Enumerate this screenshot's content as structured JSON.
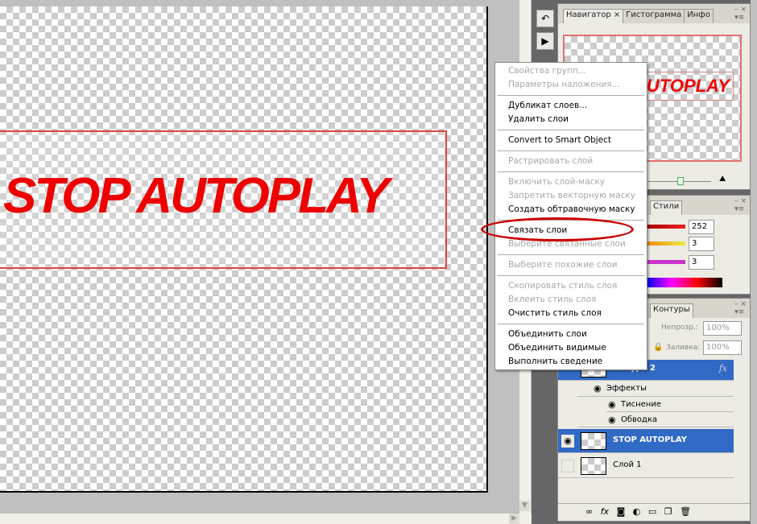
{
  "canvas": {
    "banner_text": "STOP AUTOPLAY"
  },
  "navigator": {
    "tabs": [
      "Навигатор",
      "Гистограмма",
      "Инфо"
    ],
    "close_tab_glyph": "×",
    "preview_text": "AUTOPLAY"
  },
  "color_panel": {
    "tab": "Стили",
    "values": [
      "252",
      "3",
      "3"
    ]
  },
  "layers_panel": {
    "tab": "Контуры",
    "opacity_label": "Непрозр.:",
    "opacity_value": "100%",
    "fill_label": "Заливка:",
    "fill_value": "100%",
    "layers": [
      {
        "name": "Фигура 2",
        "fx": "fx"
      },
      {
        "name": "Эффекты"
      },
      {
        "name": "Тиснение"
      },
      {
        "name": "Обводка"
      },
      {
        "name": "STOP AUTOPLAY"
      },
      {
        "name": "Слой 1"
      }
    ]
  },
  "context_menu": {
    "groups": [
      [
        {
          "label": "Свойства групп...",
          "enabled": false
        },
        {
          "label": "Параметры наложения...",
          "enabled": false
        }
      ],
      [
        {
          "label": "Дубликат слоев...",
          "enabled": true
        },
        {
          "label": "Удалить слои",
          "enabled": true
        }
      ],
      [
        {
          "label": "Convert to Smart Object",
          "enabled": true
        }
      ],
      [
        {
          "label": "Растрировать слой",
          "enabled": false
        }
      ],
      [
        {
          "label": "Включить слой-маску",
          "enabled": false
        },
        {
          "label": "Запретить векторную маску",
          "enabled": false
        },
        {
          "label": "Создать обтравочную маску",
          "enabled": true
        }
      ],
      [
        {
          "label": "Связать слои",
          "enabled": true
        },
        {
          "label": "Выберите связанные слои",
          "enabled": false
        }
      ],
      [
        {
          "label": "Выберите похожие слои",
          "enabled": false
        }
      ],
      [
        {
          "label": "Скопировать стиль слоя",
          "enabled": false
        },
        {
          "label": "Вклеить стиль слоя",
          "enabled": false
        },
        {
          "label": "Очистить стиль слоя",
          "enabled": true
        }
      ],
      [
        {
          "label": "Объединить слои",
          "enabled": true
        },
        {
          "label": "Объединить видимые",
          "enabled": true
        },
        {
          "label": "Выполнить сведение",
          "enabled": true
        }
      ]
    ]
  },
  "colors": {
    "accent": "#316ac5",
    "highlight_ellipse": "#cc0000",
    "banner": "#ee0000"
  }
}
